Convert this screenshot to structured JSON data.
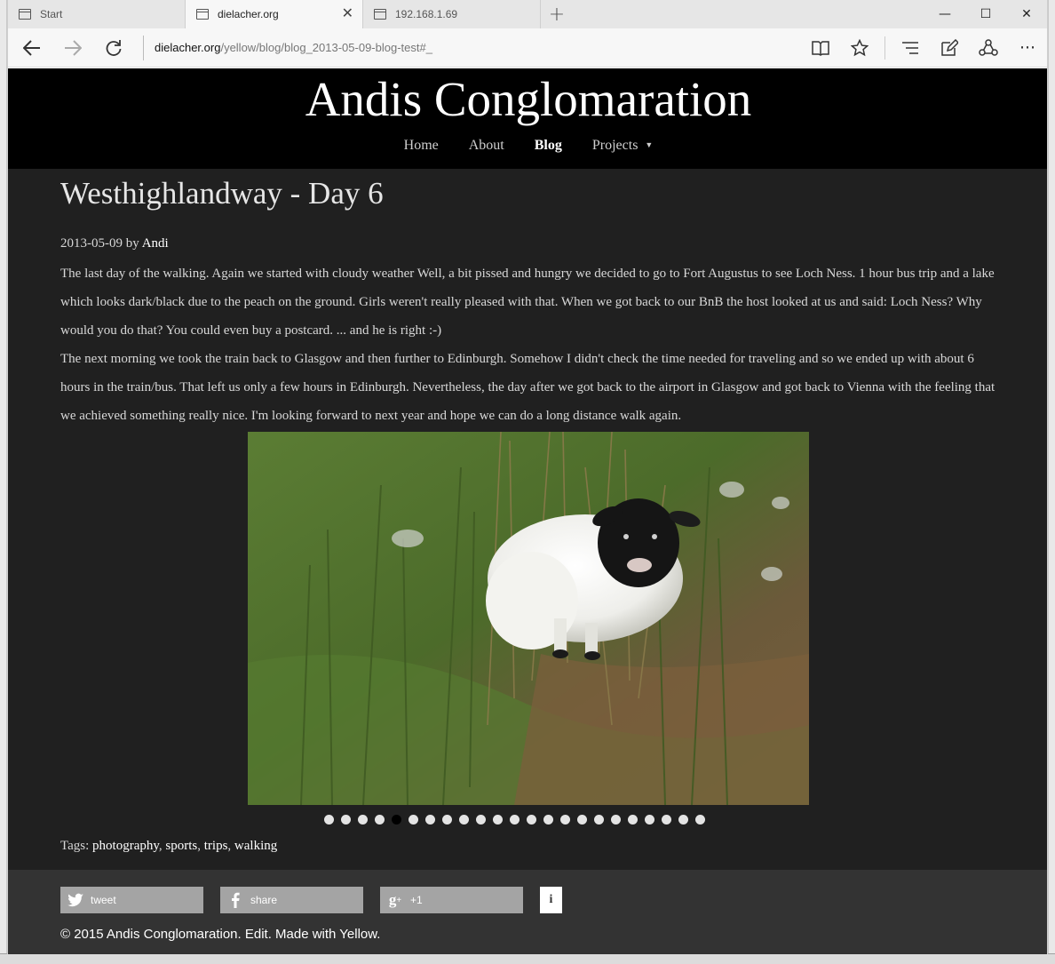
{
  "browser": {
    "tabs": [
      {
        "title": "Start",
        "active": false
      },
      {
        "title": "dielacher.org",
        "active": true
      },
      {
        "title": "192.168.1.69",
        "active": false
      }
    ],
    "address_host": "dielacher.org",
    "address_path": "/yellow/blog/blog_2013-05-09-blog-test#_"
  },
  "site": {
    "title": "Andis Conglomaration",
    "nav": [
      {
        "label": "Home"
      },
      {
        "label": "About"
      },
      {
        "label": "Blog",
        "active": true
      },
      {
        "label": "Projects"
      }
    ]
  },
  "post": {
    "title": "Westhighlandway - Day 6",
    "date": "2013-05-09",
    "by": "by",
    "author": "Andi",
    "paragraphs": [
      "The last day of the walking. Again we started with cloudy weather Well, a bit pissed and hungry we decided to go to Fort Augustus to see Loch Ness. 1 hour bus trip and a lake which looks dark/black due to the peach on the ground. Girls weren't really pleased with that. When we got back to our BnB the host looked at us and said: Loch Ness? Why would you do that? You could even buy a postcard. ... and he is right :-)",
      "The next morning we took the train back to Glasgow and then further to Edinburgh. Somehow I didn't check the time needed for traveling and so we ended up with about 6 hours in the train/bus. That left us only a few hours in Edinburgh. Nevertheless, the day after we got back to the airport in Glasgow and got back to Vienna with the feeling that we achieved something really nice. I'm looking forward to next year and hope we can do a long distance walk again."
    ],
    "gallery_count": 23,
    "gallery_active_index": 4,
    "tags_label": "Tags:",
    "tags": [
      "photography",
      "sports",
      "trips",
      "walking"
    ]
  },
  "footer": {
    "share": [
      {
        "label": "tweet",
        "icon": "twitter-icon"
      },
      {
        "label": "share",
        "icon": "facebook-icon"
      },
      {
        "label": "+1",
        "icon": "google-plus-icon"
      }
    ],
    "copyright": "© 2015 Andis Conglomaration. Edit. Made with Yellow."
  }
}
